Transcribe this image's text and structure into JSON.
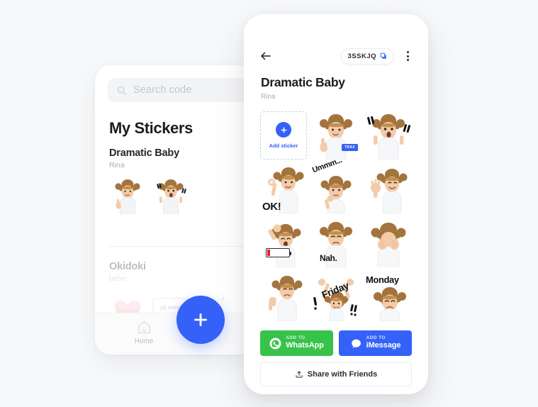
{
  "theme": {
    "page_bg": "#F7F8F9",
    "accent_blue": "#3461F7",
    "whatsapp_green": "#37C24A",
    "imessage_blue": "#3461F7",
    "text_dark": "#1C1D21",
    "text_muted": "#A9ADB4"
  },
  "left_screen": {
    "search": {
      "icon": "search-icon",
      "placeholder": "Search code",
      "value": ""
    },
    "page_title": "My Stickers",
    "packs": [
      {
        "name": "Dramatic Baby",
        "author": "Rina",
        "faded": false,
        "stickers": [
          {
            "id": "thumbsup",
            "label": "thumbs up baby"
          },
          {
            "id": "shock",
            "label": "shocked baby with exclamations"
          }
        ]
      },
      {
        "name": "Okidoki",
        "author": "bebe",
        "faded": true,
        "stickers": [
          {
            "id": "gracias",
            "label": "Gracias heart"
          },
          {
            "id": "qonda",
            "label": "Q onda bubble"
          },
          {
            "id": "greentext",
            "label": "green lettering"
          }
        ]
      }
    ],
    "bottom_nav": [
      {
        "icon": "home-icon",
        "label": "Home",
        "active": true
      }
    ],
    "fab": {
      "icon": "plus-icon",
      "label": "Add pack"
    }
  },
  "right_screen": {
    "topbar": {
      "back_icon": "arrow-left-icon",
      "code": "3SSKJQ",
      "copy_icon": "copy-icon",
      "menu_icon": "kebab-menu-icon"
    },
    "title": "Dramatic Baby",
    "author": "Rina",
    "add_tile": {
      "icon": "plus-icon",
      "label": "Add sticker"
    },
    "stickers": [
      {
        "id": "thumbsup",
        "overlay": "",
        "badge": "TRAX"
      },
      {
        "id": "shock",
        "overlay": "",
        "badge": ""
      },
      {
        "id": "ok",
        "overlay": "OK!",
        "badge": ""
      },
      {
        "id": "ummm",
        "overlay": "Ummm...",
        "badge": ""
      },
      {
        "id": "wave",
        "overlay": "",
        "badge": ""
      },
      {
        "id": "battery",
        "overlay": "",
        "badge": ""
      },
      {
        "id": "nah",
        "overlay": "Nah.",
        "badge": ""
      },
      {
        "id": "peekaboo",
        "overlay": "",
        "badge": ""
      },
      {
        "id": "thumbsdown",
        "overlay": "",
        "badge": ""
      },
      {
        "id": "friday",
        "overlay": "Friday",
        "badge": ""
      },
      {
        "id": "monday",
        "overlay": "Monday",
        "badge": ""
      }
    ],
    "actions": {
      "whatsapp": {
        "small": "ADD TO",
        "big": "WhatsApp",
        "icon": "whatsapp-icon"
      },
      "imessage": {
        "small": "ADD TO",
        "big": "iMessage",
        "icon": "imessage-icon"
      },
      "share": {
        "label": "Share with Friends",
        "icon": "share-upload-icon"
      }
    }
  }
}
